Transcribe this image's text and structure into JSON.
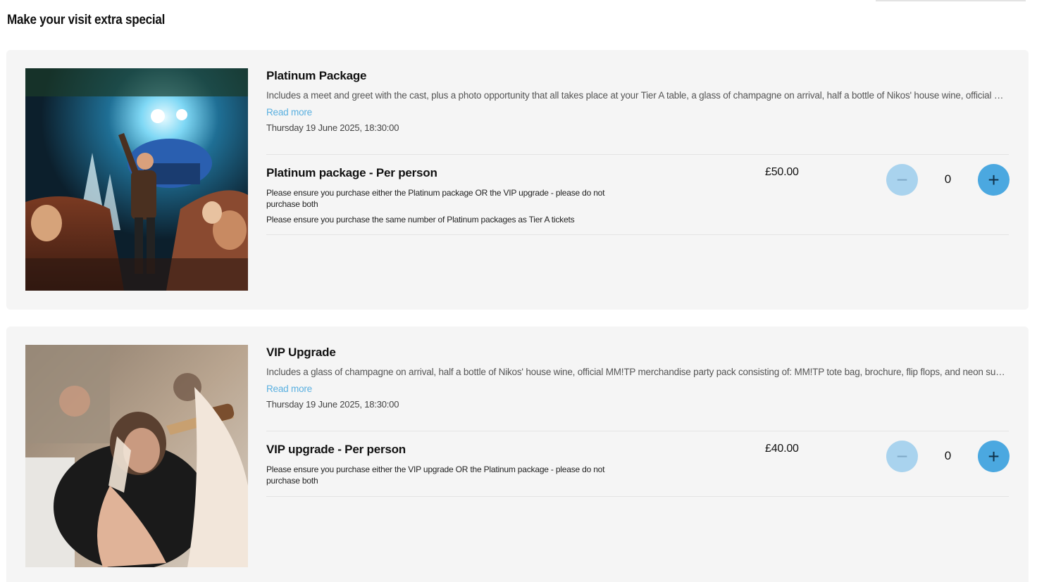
{
  "page": {
    "section_title": "Make your visit extra special"
  },
  "packages": [
    {
      "title": "Platinum Package",
      "description": "Includes a meet and greet with the cast, plus a photo opportunity that all takes place at your Tier A table, a glass of champagne on arrival, half a bottle of Nikos' house wine, official MM!TP merc...",
      "read_more": "Read more",
      "date": "Thursday 19 June 2025, 18:30:00",
      "option": {
        "title": "Platinum package - Per person",
        "notes": [
          "Please ensure you purchase either the Platinum package OR the VIP upgrade - please do not purchase both",
          "Please ensure you purchase the same number of Platinum packages as Tier A tickets"
        ],
        "price": "£50.00",
        "quantity": "0"
      }
    },
    {
      "title": "VIP Upgrade",
      "description": "Includes a glass of champagne on arrival, half a bottle of Nikos' house wine, official MM!TP merchandise party pack consisting of: MM!TP tote bag, brochure, flip flops, and neon sunglasses",
      "read_more": "Read more",
      "date": "Thursday 19 June 2025, 18:30:00",
      "option": {
        "title": "VIP upgrade - Per person",
        "notes": [
          "Please ensure you purchase either the VIP upgrade OR the Platinum package - please do not purchase both"
        ],
        "price": "£40.00",
        "quantity": "0"
      }
    }
  ],
  "icons": {
    "minus": "minus-icon",
    "plus": "plus-icon"
  },
  "colors": {
    "link": "#5ab0e0",
    "plus_button": "#4ba8e0",
    "minus_button_disabled": "#a9d3ee",
    "card_background": "#f5f5f5"
  }
}
